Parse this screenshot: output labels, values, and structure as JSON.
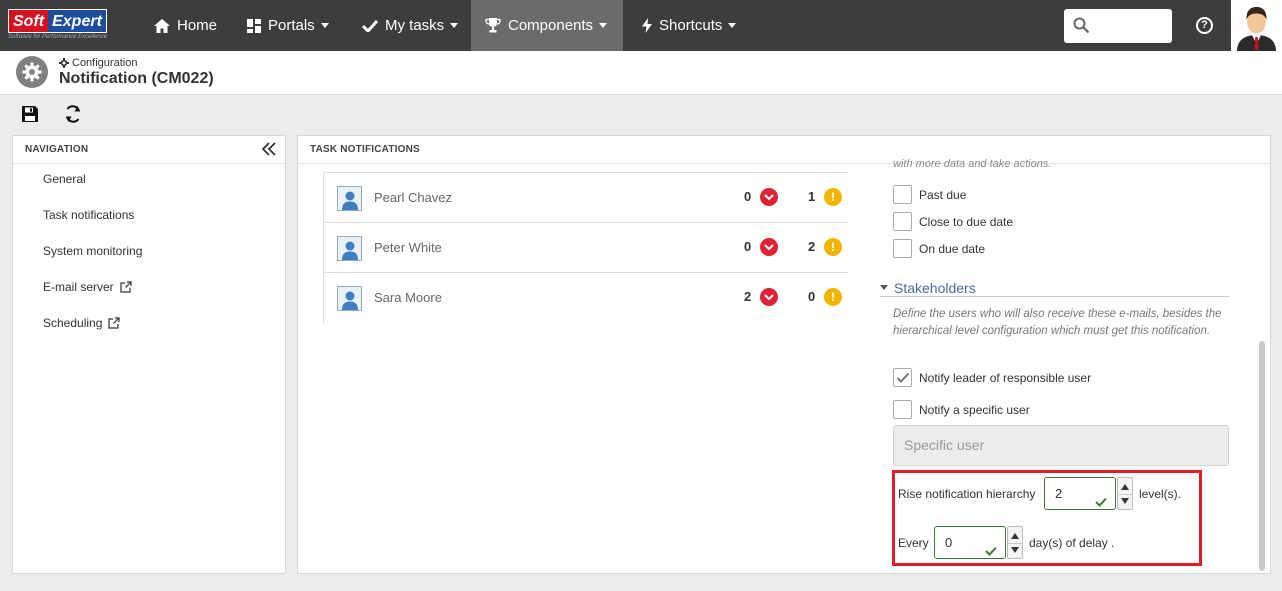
{
  "topbar": {
    "logo": {
      "part1": "Soft",
      "part2": "Expert",
      "tagline": "Software for Performance Excellence"
    },
    "nav": [
      {
        "label": "Home",
        "icon": "home-icon",
        "has_dropdown": false,
        "active": false
      },
      {
        "label": "Portals",
        "icon": "portals-icon",
        "has_dropdown": true,
        "active": false
      },
      {
        "label": "My tasks",
        "icon": "check-icon",
        "has_dropdown": true,
        "active": false
      },
      {
        "label": "Components",
        "icon": "trophy-icon",
        "has_dropdown": true,
        "active": true
      },
      {
        "label": "Shortcuts",
        "icon": "bolt-icon",
        "has_dropdown": true,
        "active": false
      }
    ],
    "search": {
      "placeholder": ""
    },
    "help_label": "?"
  },
  "header": {
    "breadcrumb": "Configuration",
    "title": "Notification (CM022)"
  },
  "toolbar": {
    "buttons": [
      "save-icon",
      "refresh-icon"
    ]
  },
  "navigation": {
    "heading": "NAVIGATION",
    "items": [
      {
        "label": "General",
        "external": false
      },
      {
        "label": "Task notifications",
        "external": false
      },
      {
        "label": "System monitoring",
        "external": false
      },
      {
        "label": "E-mail server",
        "external": true
      },
      {
        "label": "Scheduling",
        "external": true
      }
    ]
  },
  "main": {
    "heading": "TASK NOTIFICATIONS",
    "users": [
      {
        "name": "Pearl Chavez",
        "overdue": "0",
        "warning": "1"
      },
      {
        "name": "Peter White",
        "overdue": "0",
        "warning": "2"
      },
      {
        "name": "Sara Moore",
        "overdue": "2",
        "warning": "0"
      }
    ],
    "faded_text": "with more data and take actions.",
    "due_options": [
      {
        "label": "Past due",
        "checked": false
      },
      {
        "label": "Close to due date",
        "checked": false
      },
      {
        "label": "On due date",
        "checked": false
      }
    ],
    "stakeholders": {
      "title": "Stakeholders",
      "description": "Define the users who will also receive these e-mails, besides the hierarchical level configuration which must get this notification.",
      "notify_leader": {
        "label": "Notify leader of responsible user",
        "checked": true
      },
      "notify_specific": {
        "label": "Notify a specific user",
        "checked": false
      },
      "specific_user_placeholder": "Specific user",
      "rise_label": "Rise notification hierarchy",
      "rise_value": "2",
      "rise_suffix": "level(s).",
      "every_label": "Every",
      "every_value": "0",
      "every_suffix": "day(s) of delay ."
    }
  },
  "colors": {
    "topbar": "#3d3d3d",
    "active_nav": "#6b6b6b",
    "red_badge": "#e02237",
    "yellow_badge": "#f1b400",
    "highlight": "#e11d2a",
    "link": "#4a6aa5"
  }
}
